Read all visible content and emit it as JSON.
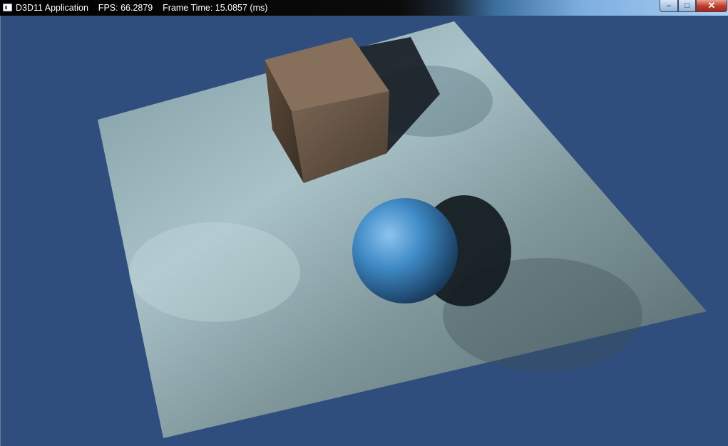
{
  "window": {
    "title": "D3D11 Application    FPS: 66.2879    Frame Time: 15.0857 (ms)",
    "controls": {
      "minimize": "–",
      "maximize": "□",
      "close": "✕"
    }
  },
  "scene": {
    "clear_color": "#2f4d7d",
    "floor_color": "#8fa9b0",
    "box_color": "#6e5a48",
    "sphere_color": "#3f8ac6"
  }
}
